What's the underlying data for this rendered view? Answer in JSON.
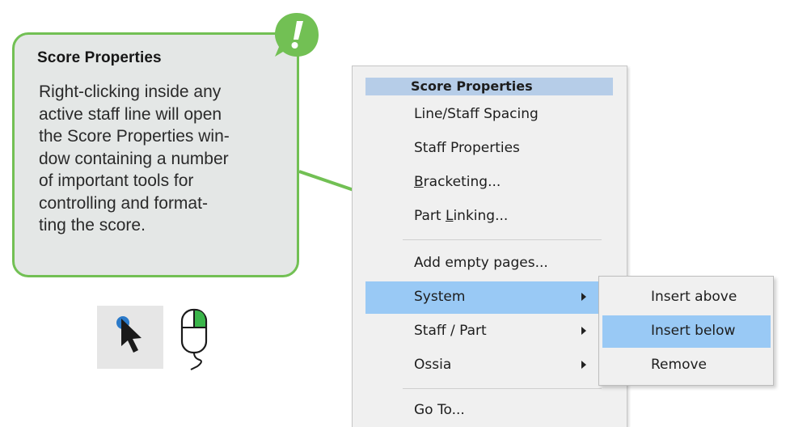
{
  "callout": {
    "title": "Score Properties",
    "lines": [
      "Right-clicking inside any",
      "active staff line will open",
      "the Score Properties win-",
      "dow containing a number",
      "of important tools for",
      "controlling and format-",
      "ting the score."
    ],
    "badge_symbol": "!",
    "accent_color": "#72c054",
    "box_color": "#e4e7e6"
  },
  "mouse_hint": {
    "pointer_icon": "cursor-arrow-icon",
    "mouse_icon": "mouse-right-click-icon",
    "click_color": "#3ab54a"
  },
  "menu": {
    "header": "Score Properties",
    "items": {
      "line_staff_spacing": "Line/Staff Spacing",
      "staff_properties": "Staff Properties",
      "bracketing": {
        "pre": "",
        "u": "B",
        "post": "racketing..."
      },
      "part_linking": {
        "pre": "Part ",
        "u": "L",
        "post": "inking..."
      },
      "add_empty_pages": "Add empty pages...",
      "system": "System",
      "staff_part": "Staff / Part",
      "ossia": "Ossia",
      "go_to": "Go To..."
    },
    "highlight_color": "#99c9f5",
    "header_color": "#b6cde8"
  },
  "submenu": {
    "items": [
      "Insert above",
      "Insert below",
      "Remove"
    ],
    "highlighted": "Insert below"
  }
}
